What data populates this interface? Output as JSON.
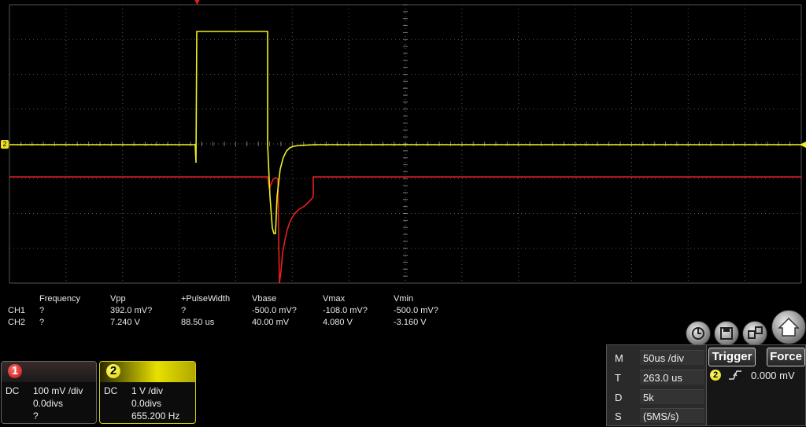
{
  "markers": {
    "trigger_position_glyph": "▼",
    "channel2_level_badge": "2"
  },
  "measurements": {
    "headers": [
      "Frequency",
      "Vpp",
      "+PulseWidth",
      "Vbase",
      "Vmax",
      "Vmin"
    ],
    "rows": [
      {
        "channel": "CH1",
        "values": [
          "?",
          "392.0 mV?",
          "?",
          "-500.0 mV?",
          "-108.0 mV?",
          "-500.0 mV?"
        ]
      },
      {
        "channel": "CH2",
        "values": [
          "?",
          "7.240 V",
          "88.50 us",
          "40.00 mV",
          "4.080 V",
          "-3.160 V"
        ]
      }
    ]
  },
  "channel1": {
    "number": "1",
    "coupling": "DC",
    "scale": "100 mV /div",
    "offset": "0.0divs",
    "frequency": "?",
    "color": "#e82020"
  },
  "channel2": {
    "number": "2",
    "coupling": "DC",
    "scale": "1 V /div",
    "offset": "0.0divs",
    "frequency": "655.200 Hz",
    "color": "#f0f020"
  },
  "horizontal": {
    "rows": [
      {
        "key": "M",
        "value": "50us /div"
      },
      {
        "key": "T",
        "value": "263.0 us"
      },
      {
        "key": "D",
        "value": "5k"
      },
      {
        "key": "S",
        "value": "(5MS/s)"
      }
    ]
  },
  "trigger": {
    "label": "Trigger",
    "force_label": "Force",
    "source": "2",
    "slope": "rising-edge-icon",
    "level": "0.000 mV"
  },
  "toolbar": {
    "icons": [
      "auto-scale-icon",
      "save-icon",
      "screen-copy-icon",
      "home-icon"
    ]
  }
}
